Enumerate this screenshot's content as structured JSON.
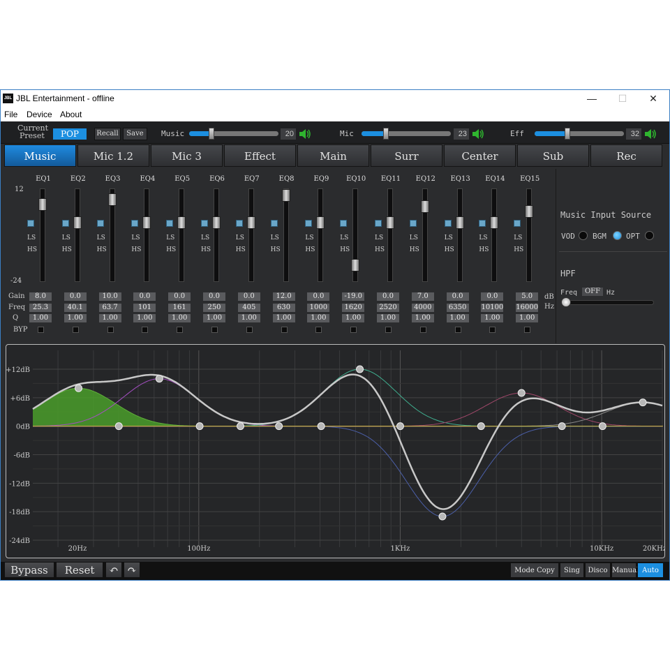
{
  "window": {
    "title": "JBL Entertainment - offline",
    "logo_text": "JBL",
    "minimize": "—",
    "maximize": "☐",
    "close": "✕"
  },
  "menu": [
    "File",
    "Device",
    "About"
  ],
  "topbar": {
    "current_preset_label_1": "Current",
    "current_preset_label_2": "Preset",
    "preset": "POP",
    "recall": "Recall",
    "save": "Save",
    "music_label": "Music",
    "music_value": "20",
    "music_level": 0.2,
    "mic_label": "Mic",
    "mic_value": "23",
    "mic_level": 0.23,
    "eff_label": "Eff",
    "eff_value": "32",
    "eff_level": 0.32
  },
  "tabs": [
    "Music",
    "Mic 1.2",
    "Mic 3",
    "Effect",
    "Main",
    "Surr",
    "Center",
    "Sub",
    "Rec"
  ],
  "active_tab": "Music",
  "eq": {
    "scale_top": "12",
    "scale_bottom": "-24",
    "ls": "LS",
    "hs": "HS",
    "row_labels": {
      "gain": "Gain",
      "freq": "Freq",
      "q": "Q",
      "byp": "BYP"
    },
    "units": {
      "db": "dB",
      "hz": "Hz"
    },
    "bands": [
      {
        "name": "EQ1",
        "gain": "8.0",
        "freq": "25.3",
        "q": "1.00",
        "gain_db": 8
      },
      {
        "name": "EQ2",
        "gain": "0.0",
        "freq": "40.1",
        "q": "1.00",
        "gain_db": 0
      },
      {
        "name": "EQ3",
        "gain": "10.0",
        "freq": "63.7",
        "q": "1.00",
        "gain_db": 10
      },
      {
        "name": "EQ4",
        "gain": "0.0",
        "freq": "101",
        "q": "1.00",
        "gain_db": 0
      },
      {
        "name": "EQ5",
        "gain": "0.0",
        "freq": "161",
        "q": "1.00",
        "gain_db": 0
      },
      {
        "name": "EQ6",
        "gain": "0.0",
        "freq": "250",
        "q": "1.00",
        "gain_db": 0
      },
      {
        "name": "EQ7",
        "gain": "0.0",
        "freq": "405",
        "q": "1.00",
        "gain_db": 0
      },
      {
        "name": "EQ8",
        "gain": "12.0",
        "freq": "630",
        "q": "1.00",
        "gain_db": 12
      },
      {
        "name": "EQ9",
        "gain": "0.0",
        "freq": "1000",
        "q": "1.00",
        "gain_db": 0
      },
      {
        "name": "EQ10",
        "gain": "-19.0",
        "freq": "1620",
        "q": "1.00",
        "gain_db": -19
      },
      {
        "name": "EQ11",
        "gain": "0.0",
        "freq": "2520",
        "q": "1.00",
        "gain_db": 0
      },
      {
        "name": "EQ12",
        "gain": "7.0",
        "freq": "4000",
        "q": "1.00",
        "gain_db": 7
      },
      {
        "name": "EQ13",
        "gain": "0.0",
        "freq": "6350",
        "q": "1.00",
        "gain_db": 0
      },
      {
        "name": "EQ14",
        "gain": "0.0",
        "freq": "10100",
        "q": "1.00",
        "gain_db": 0
      },
      {
        "name": "EQ15",
        "gain": "5.0",
        "freq": "16000",
        "q": "1.00",
        "gain_db": 5
      }
    ]
  },
  "right_panel": {
    "music_input_source": "Music Input Source",
    "sources": [
      "VOD",
      "BGM",
      "OPT"
    ],
    "selected_source": "OPT",
    "hpf_label": "HPF",
    "freq_label": "Freq",
    "freq_value": "OFF",
    "hz": "Hz"
  },
  "graph": {
    "y_labels": [
      "+12dB",
      "+6dB",
      "0dB",
      "-6dB",
      "-12dB",
      "-18dB",
      "-24dB"
    ],
    "x_labels": [
      "20Hz",
      "100Hz",
      "1KHz",
      "10KHz",
      "20KHz"
    ]
  },
  "bottom": {
    "bypass": "Bypass",
    "reset": "Reset",
    "undo": "↶",
    "redo": "↷",
    "modes": [
      "Mode Copy",
      "Sing",
      "Disco",
      "Manual",
      "Auto"
    ],
    "active_mode": "Auto"
  },
  "colors": {
    "accent": "#1c8fe0",
    "background": "#2b2c2e",
    "curve": "#c8c8c8",
    "fill_green": "#4a9e2a"
  }
}
